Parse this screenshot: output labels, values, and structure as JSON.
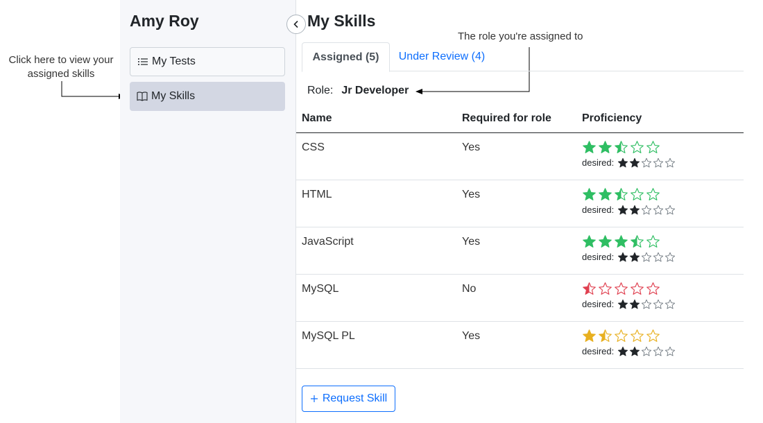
{
  "annotations": {
    "left_note": "Click here to view your assigned skills",
    "top_note": "The role you're assigned to"
  },
  "sidebar": {
    "user_name": "Amy Roy",
    "items": [
      {
        "label": "My Tests",
        "icon": "list-icon"
      },
      {
        "label": "My Skills",
        "icon": "book-icon"
      }
    ]
  },
  "page": {
    "title": "My Skills",
    "tabs": [
      {
        "label": "Assigned (5)",
        "active": true
      },
      {
        "label": "Under Review (4)",
        "active": false
      }
    ],
    "role_label": "Role:",
    "role_value": "Jr Developer"
  },
  "table": {
    "headers": [
      "Name",
      "Required for role",
      "Proficiency"
    ],
    "desired_label": "desired:",
    "rows": [
      {
        "name": "CSS",
        "required": "Yes",
        "rating": 2.5,
        "desired": 2,
        "color": "#2fbe63"
      },
      {
        "name": "HTML",
        "required": "Yes",
        "rating": 2.5,
        "desired": 2,
        "color": "#2fbe63"
      },
      {
        "name": "JavaScript",
        "required": "Yes",
        "rating": 3.5,
        "desired": 2,
        "color": "#2fbe63"
      },
      {
        "name": "MySQL",
        "required": "No",
        "rating": 0.5,
        "desired": 2,
        "color": "#e04050"
      },
      {
        "name": "MySQL PL",
        "required": "Yes",
        "rating": 1.5,
        "desired": 2,
        "color": "#e8b020"
      }
    ]
  },
  "actions": {
    "request_skill": "Request Skill"
  },
  "colors": {
    "accent": "#0d6efd",
    "sidebar_bg": "#f6f7fa",
    "active_nav_bg": "#d3d7e3"
  }
}
